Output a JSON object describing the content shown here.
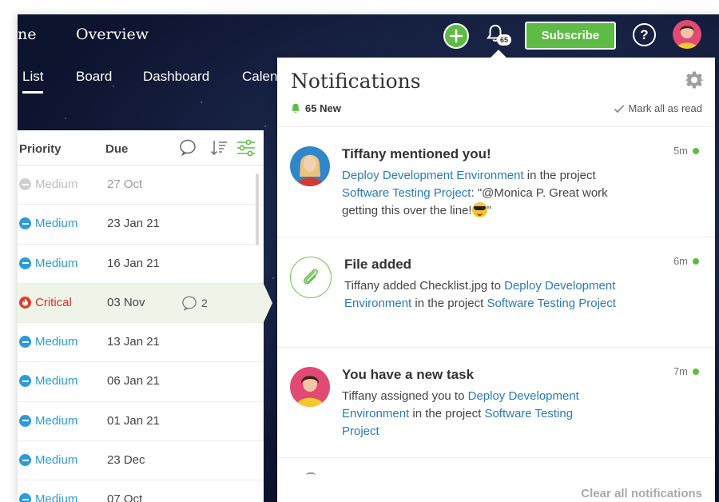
{
  "topbar": {
    "breadcrumb_a": "ne",
    "breadcrumb_b": "Overview",
    "notification_count": "65",
    "subscribe_label": "Subscribe",
    "help_label": "?"
  },
  "tabs": [
    {
      "label": "List"
    },
    {
      "label": "Board"
    },
    {
      "label": "Dashboard"
    },
    {
      "label": "Calen"
    }
  ],
  "task_table": {
    "headers": {
      "priority": "Priority",
      "due": "Due"
    },
    "rows": [
      {
        "priority": "Medium",
        "due": "27 Oct",
        "comments": ""
      },
      {
        "priority": "Medium",
        "due": "23 Jan 21",
        "comments": ""
      },
      {
        "priority": "Medium",
        "due": "16 Jan 21",
        "comments": ""
      },
      {
        "priority": "Critical",
        "due": "03 Nov",
        "comments": "2"
      },
      {
        "priority": "Medium",
        "due": "13 Jan 21",
        "comments": ""
      },
      {
        "priority": "Medium",
        "due": "06 Jan 21",
        "comments": ""
      },
      {
        "priority": "Medium",
        "due": "01 Jan 21",
        "comments": ""
      },
      {
        "priority": "Medium",
        "due": "23 Dec",
        "comments": ""
      },
      {
        "priority": "Medium",
        "due": "07 Oct",
        "comments": ""
      }
    ]
  },
  "notifications": {
    "title": "Notifications",
    "new_count": "65 New",
    "mark_all_label": "Mark all as read",
    "clear_all_label": "Clear all notifications",
    "items": [
      {
        "heading": "Tiffany mentioned you!",
        "time": "5m",
        "link1": "Deploy Development Environment",
        "text1": " in the project ",
        "link2": "Software Testing Project",
        "text2": ": \"@Monica P. Great work getting this over the line!",
        "text3": "\""
      },
      {
        "heading": "File added",
        "time": "6m",
        "text1": "Tiffany added Checklist.jpg to ",
        "link1": "Deploy Development Environment",
        "text2": " in the project ",
        "link2": "Software Testing Project"
      },
      {
        "heading": "You have a new task",
        "time": "7m",
        "text1": "Tiffany assigned you to ",
        "link1": "Deploy Development Environment",
        "text2": " in the project ",
        "link2": "Software Testing Project"
      }
    ]
  },
  "colors": {
    "accent_green": "#5dbb46",
    "link_blue": "#2a7ab8",
    "medium_blue": "#2d9bd8",
    "critical_red": "#d9312b"
  }
}
